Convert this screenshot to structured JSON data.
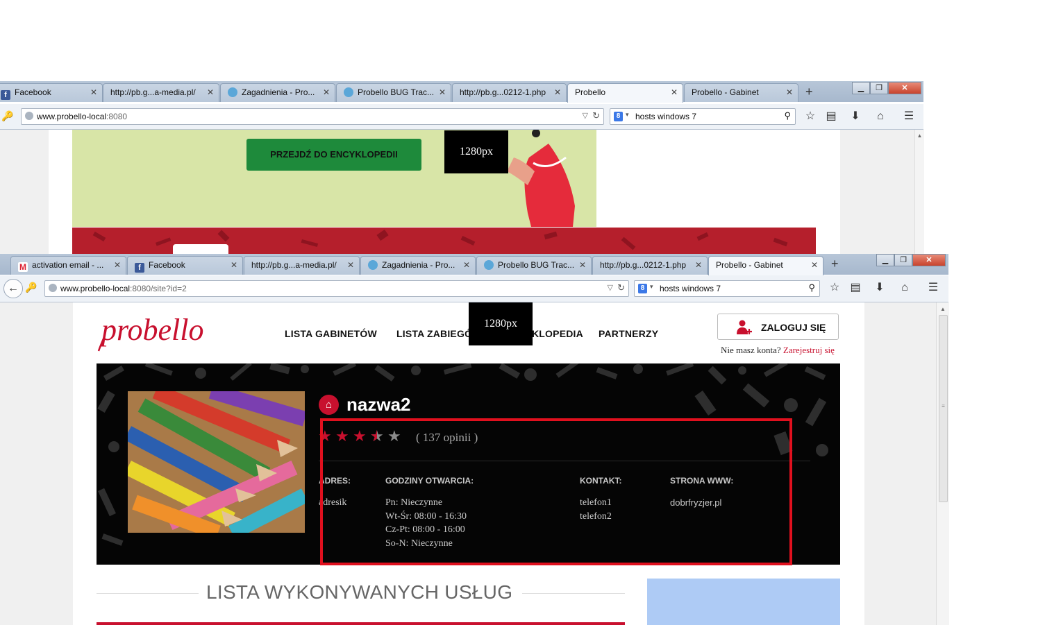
{
  "window1": {
    "tabs": [
      {
        "label": "Facebook",
        "icon": "facebook-icon"
      },
      {
        "label": "http://pb.g...a-media.pl/",
        "icon": ""
      },
      {
        "label": "Zagadnienia - Pro...",
        "icon": "gear-icon"
      },
      {
        "label": "Probello BUG Trac...",
        "icon": "gear-icon"
      },
      {
        "label": "http://pb.g...0212-1.php",
        "icon": ""
      },
      {
        "label": "Probello",
        "icon": "",
        "active": true
      },
      {
        "label": "Probello - Gabinet",
        "icon": ""
      }
    ],
    "url_host": "www.probello-local",
    "url_rest": ":8080",
    "search_value": "hosts windows 7",
    "encyclopedia_button": "PRZEJDŹ DO ENCYKLOPEDII",
    "overlay_label": "1280px"
  },
  "window2": {
    "tabs": [
      {
        "label": "activation email - ...",
        "icon": "gmail-icon"
      },
      {
        "label": "Facebook",
        "icon": "facebook-icon"
      },
      {
        "label": "http://pb.g...a-media.pl/",
        "icon": ""
      },
      {
        "label": "Zagadnienia - Pro...",
        "icon": "gear-icon"
      },
      {
        "label": "Probello BUG Trac...",
        "icon": "gear-icon"
      },
      {
        "label": "http://pb.g...0212-1.php",
        "icon": ""
      },
      {
        "label": "Probello - Gabinet",
        "icon": "",
        "active": true
      }
    ],
    "url_host": "www.probello-local",
    "url_rest": ":8080/site?id=2",
    "search_value": "hosts windows 7",
    "overlay_label": "1280px"
  },
  "site": {
    "logo": "probello",
    "nav": [
      "LISTA GABINETÓW",
      "LISTA ZABIEGÓW",
      "ENCYKLOPEDIA",
      "PARTNERZY"
    ],
    "nav_visible": [
      "LISTA GABINETÓW",
      "LISTA ZABIEGÓ",
      "KLOPEDIA",
      "PARTNERZY"
    ],
    "login_button": "ZALOGUJ SIĘ",
    "no_account": "Nie masz konta?",
    "register_link": "Zarejestruj się",
    "salon": {
      "name": "nazwa2",
      "rating": 3.5,
      "rating_max": 5,
      "reviews": "( 137 opinii )",
      "address_label": "ADRES:",
      "address": "adresik",
      "hours_label": "GODZINY OTWARCIA:",
      "hours": [
        "Pn: Nieczynne",
        "Wt-Śr: 08:00 - 16:30",
        "Cz-Pt: 08:00 - 16:00",
        "So-N: Nieczynne"
      ],
      "contact_label": "KONTAKT:",
      "contacts": [
        "telefon1",
        "telefon2"
      ],
      "www_label": "STRONA WWW:",
      "www": "dobrfryzjer.pl"
    },
    "services_title": "LISTA WYKONYWANYCH USŁUG"
  },
  "colors": {
    "brand_red": "#c8102e",
    "annotation_red": "#e0101e",
    "green_button": "#1e8a3b"
  }
}
